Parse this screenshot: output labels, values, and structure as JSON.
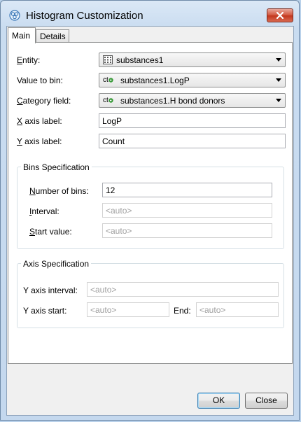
{
  "window": {
    "title": "Histogram Customization"
  },
  "tabs": [
    {
      "label": "Main",
      "selected": true
    },
    {
      "label": "Details",
      "selected": false
    }
  ],
  "form": {
    "entity": {
      "label": "Entity:",
      "value": "substances1",
      "icon": "table-grid-icon"
    },
    "value_to_bin": {
      "label": "Value to bin:",
      "value": "substances1.LogP",
      "type_tag": "ct",
      "icon": "calculated-column-icon"
    },
    "category_field": {
      "label": "Category field:",
      "value": "substances1.H bond donors",
      "type_tag": "ct",
      "icon": "calculated-column-icon"
    },
    "x_axis_label": {
      "label": "X axis label:",
      "value": "LogP"
    },
    "y_axis_label": {
      "label": "Y axis label:",
      "value": "Count"
    }
  },
  "bins": {
    "title": "Bins Specification",
    "number_of_bins": {
      "label": "Number of bins:",
      "value": "12"
    },
    "interval": {
      "label": "Interval:",
      "placeholder": "<auto>"
    },
    "start_value": {
      "label": "Start value:",
      "placeholder": "<auto>"
    }
  },
  "axis": {
    "title": "Axis Specification",
    "y_axis_interval": {
      "label": "Y axis interval:",
      "placeholder": "<auto>"
    },
    "y_axis_start": {
      "label": "Y axis start:",
      "placeholder": "<auto>"
    },
    "end": {
      "label": "End:",
      "placeholder": "<auto>"
    }
  },
  "buttons": {
    "ok": "OK",
    "close": "Close"
  },
  "colors": {
    "close_button": "#c7402a",
    "tag_green": "#3a9a3a",
    "group_border": "#d5dfe5"
  }
}
